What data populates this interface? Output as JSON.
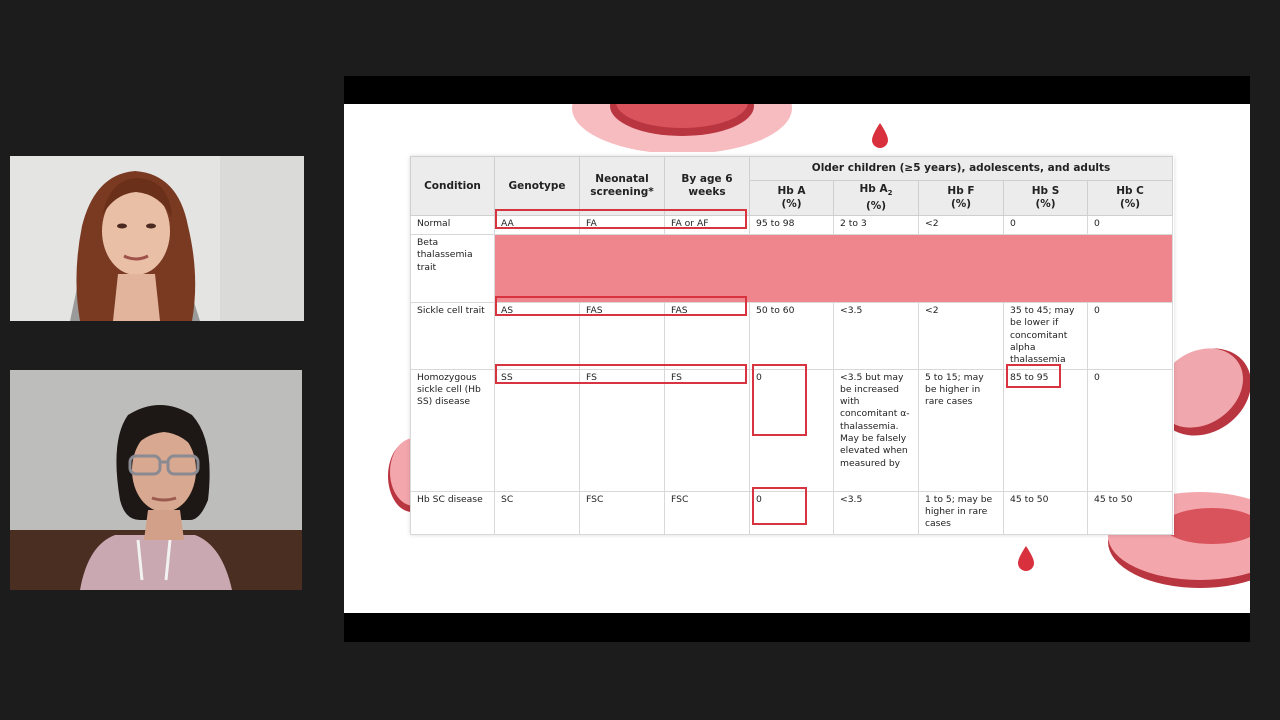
{
  "table": {
    "header_group": "Older children (≥5 years), adolescents, and adults",
    "columns": {
      "condition": "Condition",
      "genotype": "Genotype",
      "neonatal": "Neonatal screening*",
      "six_weeks": "By age 6 weeks",
      "hba_label": "Hb A",
      "hba2_label": "Hb A",
      "hba2_sub": "2",
      "hbf_label": "Hb F",
      "hbs_label": "Hb S",
      "hbc_label": "Hb C",
      "pct": "(%)"
    },
    "rows": [
      {
        "condition": "Normal",
        "genotype": "AA",
        "neonatal": "FA",
        "six_weeks": "FA or AF",
        "hba": "95 to 98",
        "hba2": "2 to 3",
        "hbf": "<2",
        "hbs": "0",
        "hbc": "0"
      },
      {
        "condition": "Beta thalassemia trait"
      },
      {
        "condition": "Sickle cell trait",
        "genotype": "AS",
        "neonatal": "FAS",
        "six_weeks": "FAS",
        "hba": "50 to 60",
        "hba2": "<3.5",
        "hbf": "<2",
        "hbs": "35 to 45; may be lower if concomitant alpha thalassemia",
        "hbc": "0"
      },
      {
        "condition": "Homozygous sickle cell (Hb SS) disease",
        "genotype": "SS",
        "neonatal": "FS",
        "six_weeks": "FS",
        "hba": "0",
        "hba2": "<3.5 but may be increased with concomitant α-thalassemia. May be falsely elevated when measured by",
        "hbf": "5 to 15; may be higher in rare cases",
        "hbs": "85 to 95",
        "hbc": "0"
      },
      {
        "condition": "Hb SC disease",
        "genotype": "SC",
        "neonatal": "FSC",
        "six_weeks": "FSC",
        "hba": "0",
        "hba2": "<3.5",
        "hbf": "1 to 5; may be higher in rare cases",
        "hbs": "45 to 50",
        "hbc": "45 to 50"
      }
    ]
  }
}
